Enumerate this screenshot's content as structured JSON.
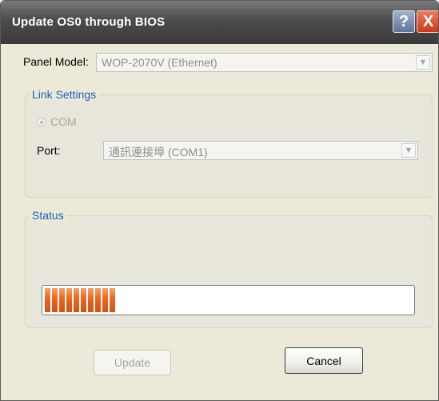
{
  "window": {
    "title": "Update OS0 through BIOS",
    "help_label": "?",
    "close_label": "X"
  },
  "panel_model": {
    "label": "Panel Model:",
    "value": "WOP-2070V (Ethernet)"
  },
  "link_settings": {
    "group_title": "Link Settings",
    "com_label": "COM",
    "port_label": "Port:",
    "port_value": "通訊連接埠 (COM1)"
  },
  "status": {
    "group_title": "Status",
    "progress_fraction": 0.19
  },
  "buttons": {
    "update_label": "Update",
    "cancel_label": "Cancel"
  }
}
